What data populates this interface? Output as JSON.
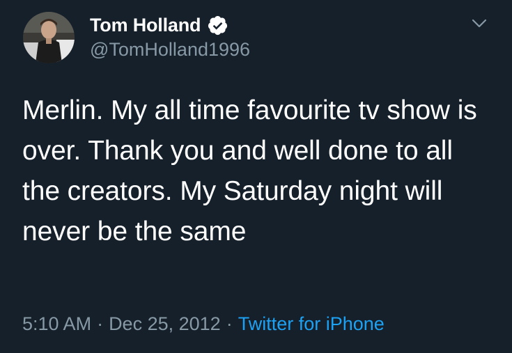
{
  "author": {
    "display_name": "Tom Holland",
    "handle": "@TomHolland1996",
    "verified": true,
    "avatar_icon": "profile-photo"
  },
  "menu": {
    "icon": "chevron-down-icon"
  },
  "tweet": {
    "text": "Merlin. My all time favourite tv show is over. Thank you and well done to all the creators. My Saturday night will never be the same"
  },
  "meta": {
    "time": "5:10 AM",
    "separator": "·",
    "date": "Dec 25, 2012",
    "source": "Twitter for iPhone"
  },
  "colors": {
    "background": "#15202b",
    "primary_text": "#ffffff",
    "secondary_text": "#8899a6",
    "accent": "#1da1f2"
  }
}
